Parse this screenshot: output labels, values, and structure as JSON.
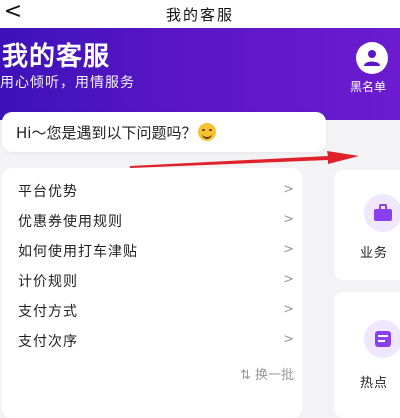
{
  "nav": {
    "back_glyph": "<",
    "title": "我的客服"
  },
  "hero": {
    "title": "我的客服",
    "subtitle": "用心倾听，用情服务",
    "blacklist_label": "黑名单",
    "blacklist_icon": "user-block-icon"
  },
  "greeting": {
    "text": "Hi～您是遇到以下问题吗？"
  },
  "faq": {
    "items": [
      {
        "label": "平台优势"
      },
      {
        "label": "优惠券使用规则"
      },
      {
        "label": "如何使用打车津贴"
      },
      {
        "label": "计价规则"
      },
      {
        "label": "支付方式"
      },
      {
        "label": "支付次序"
      }
    ],
    "chevron": ">",
    "refresh_label": "⇅ 换一批"
  },
  "side_cards": [
    {
      "label": "业务",
      "icon": "briefcase-icon"
    },
    {
      "label": "热点",
      "icon": "hot-topic-icon"
    }
  ],
  "colors": {
    "accent": "#5a16c6",
    "arrow": "#e0202a"
  }
}
